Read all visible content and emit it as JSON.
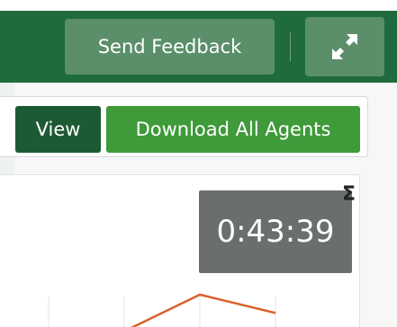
{
  "header": {
    "feedback_label": "Send Feedback",
    "expand_icon": "expand-arrows-icon",
    "background_color": "#1f6b3e",
    "button_color": "#5a8f6a"
  },
  "toolbar": {
    "view_label": "View",
    "download_label": "Download All Agents",
    "view_color": "#1d5a34",
    "download_color": "#3f9a3a"
  },
  "panel": {
    "sigma_symbol": "Σ",
    "timer_value": "0:43:39",
    "timer_color": "#6b6e6f"
  },
  "chart_data": {
    "type": "line",
    "series": [
      {
        "values": [
          null,
          null,
          0.2,
          1.0,
          0.6
        ]
      }
    ],
    "series_color": "#d9622b",
    "grid": true
  }
}
